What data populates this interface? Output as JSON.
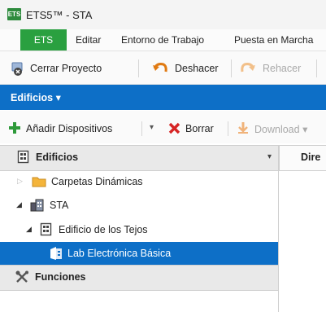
{
  "window": {
    "app_icon_text": "ETS",
    "title": "ETS5™ - STA"
  },
  "menu": {
    "ets": "ETS",
    "items": [
      "Editar",
      "Entorno de Trabajo",
      "Puesta en Marcha"
    ]
  },
  "toolbar": {
    "close_project": "Cerrar Proyecto",
    "undo": "Deshacer",
    "redo": "Rehacer"
  },
  "workspace": {
    "title": "Edificios ▾"
  },
  "actions": {
    "add_devices": "Añadir Dispositivos",
    "dropdown": "▾",
    "delete": "Borrar",
    "download": "Download ▾"
  },
  "panel": {
    "header": "Edificios",
    "header_dropdown": "▾",
    "right_header": "Dire"
  },
  "tree": {
    "items": [
      "Carpetas Dinámicas",
      "STA",
      "Edificio de los Tejos",
      "Lab Electrónica Básica"
    ]
  },
  "funciones": {
    "label": "Funciones"
  },
  "colors": {
    "accent_blue": "#0d6fc7",
    "ets_green": "#2aa040"
  }
}
